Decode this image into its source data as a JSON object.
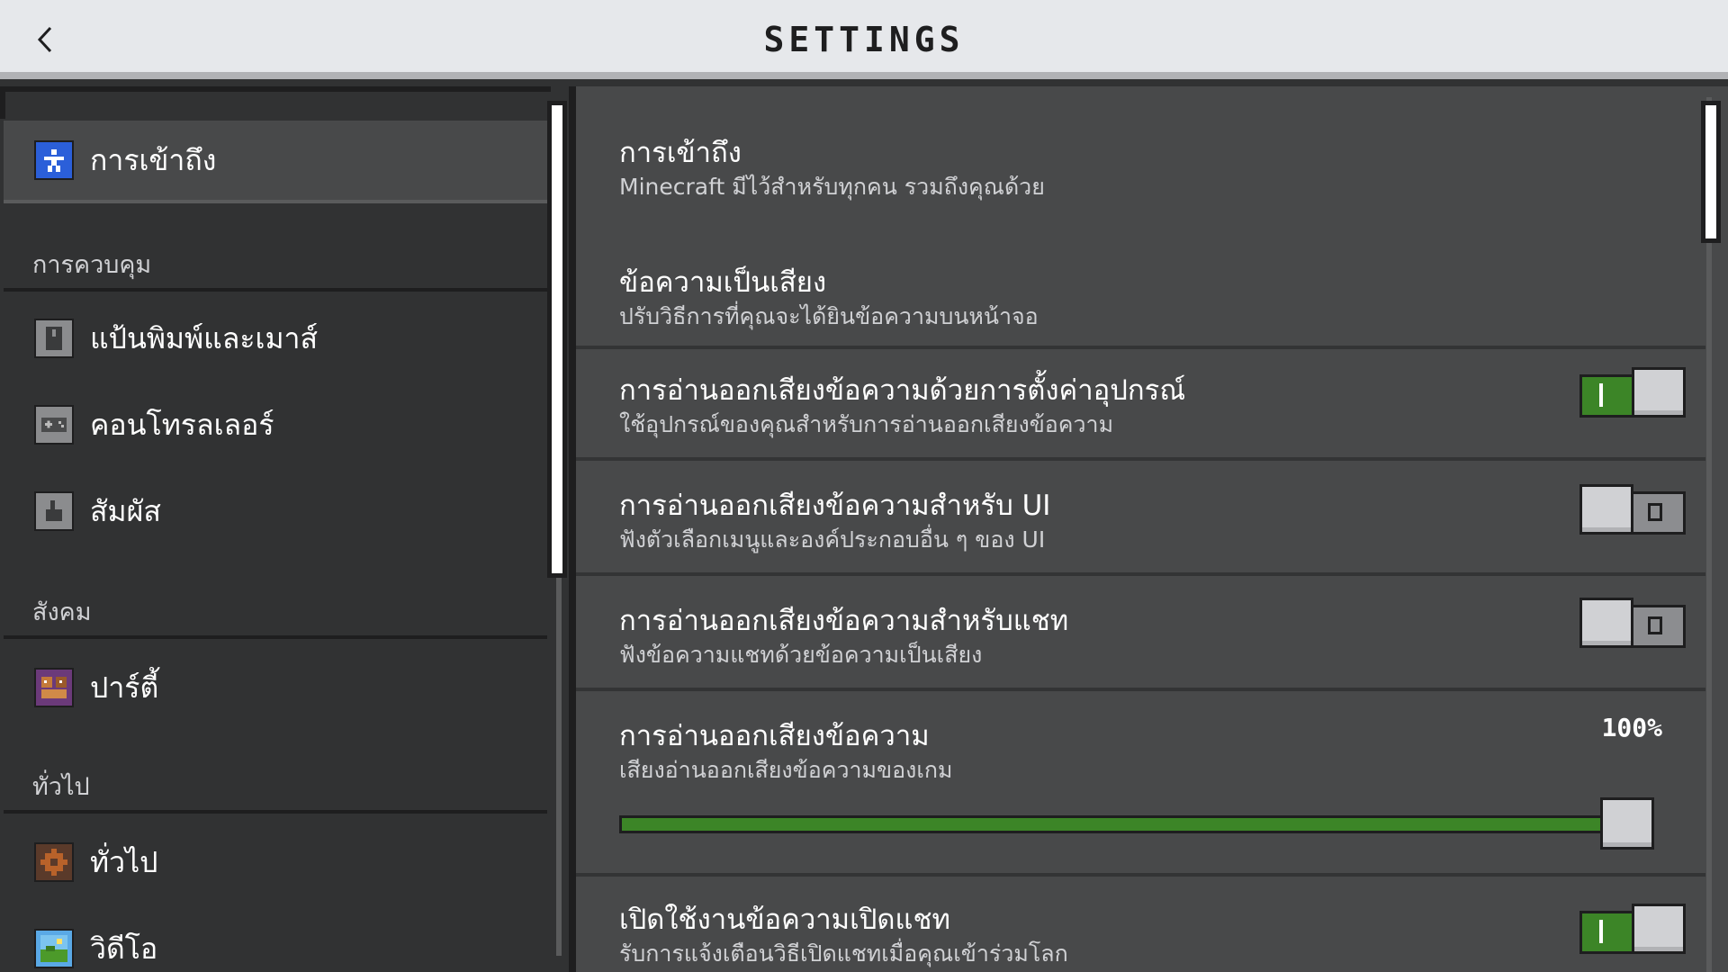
{
  "header": {
    "title": "SETTINGS",
    "back_icon": "chevron-left-icon"
  },
  "sidebar": {
    "sections": [
      {
        "label": "การควบคุม"
      },
      {
        "label": "สังคม"
      },
      {
        "label": "ทั่วไป"
      }
    ],
    "items": [
      {
        "label": "การเข้าถึง",
        "icon": "accessibility-icon",
        "active": true
      },
      {
        "label": "แป้นพิมพ์และเมาส์",
        "icon": "mouse-icon"
      },
      {
        "label": "คอนโทรลเลอร์",
        "icon": "controller-icon"
      },
      {
        "label": "สัมผัส",
        "icon": "touch-icon"
      },
      {
        "label": "ปาร์ตี้",
        "icon": "party-icon"
      },
      {
        "label": "ทั่วไป",
        "icon": "gear-icon"
      },
      {
        "label": "วิดีโอ",
        "icon": "video-icon"
      }
    ]
  },
  "main": {
    "section_title": "การเข้าถึง",
    "section_subtitle": "Minecraft มีไว้สำหรับทุกคน รวมถึงคุณด้วย",
    "tts_heading": "ข้อความเป็นเสียง",
    "tts_heading_desc": "ปรับวิธีการที่คุณจะได้ยินข้อความบนหน้าจอ",
    "settings": [
      {
        "title": "การอ่านออกเสียงข้อความด้วยการตั้งค่าอุปกรณ์",
        "desc": "ใช้อุปกรณ์ของคุณสำหรับการอ่านออกเสียงข้อความ",
        "enabled": true
      },
      {
        "title": "การอ่านออกเสียงข้อความสำหรับ UI",
        "desc": "ฟังตัวเลือกเมนูและองค์ประกอบอื่น ๆ ของ UI",
        "enabled": false
      },
      {
        "title": "การอ่านออกเสียงข้อความสำหรับแชท",
        "desc": "ฟังข้อความแชทด้วยข้อความเป็นเสียง",
        "enabled": false
      }
    ],
    "volume": {
      "title": "การอ่านออกเสียงข้อความ",
      "desc": "เสียงอ่านออกเสียงข้อความของเกม",
      "value_label": "100%",
      "value": 1.0
    },
    "open_chat": {
      "title": "เปิดใช้งานข้อความเปิดแชท",
      "desc": "รับการแจ้งเตือนวิธีเปิดแชทเมื่อคุณเข้าร่วมโลก",
      "enabled": true
    }
  },
  "colors": {
    "accent_green": "#3c8527",
    "header_bg": "#e6e8eb",
    "panel_bg": "#48494a",
    "sidebar_bg": "#313233"
  }
}
